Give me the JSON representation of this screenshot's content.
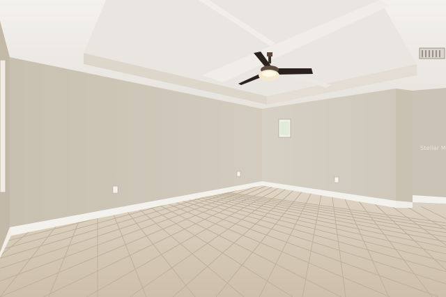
{
  "scene": {
    "description_kind": "photo",
    "watermark_text": "Stellar MLS",
    "colors": {
      "ceiling": "#ece9e4",
      "wall_left": "#cfc7b8",
      "wall_right": "#d7d1c6",
      "wall_far": "#cac2b4",
      "floor_tile": "#d4c7b4",
      "grout": "#c3b4a0",
      "baseboard": "#f4f2ee",
      "fan_blade": "#2a211c",
      "fan_light": "#f3e6c8"
    },
    "icons": [
      "ceiling-fan-icon",
      "window-icon",
      "air-vent-icon",
      "outlet-icon"
    ]
  }
}
